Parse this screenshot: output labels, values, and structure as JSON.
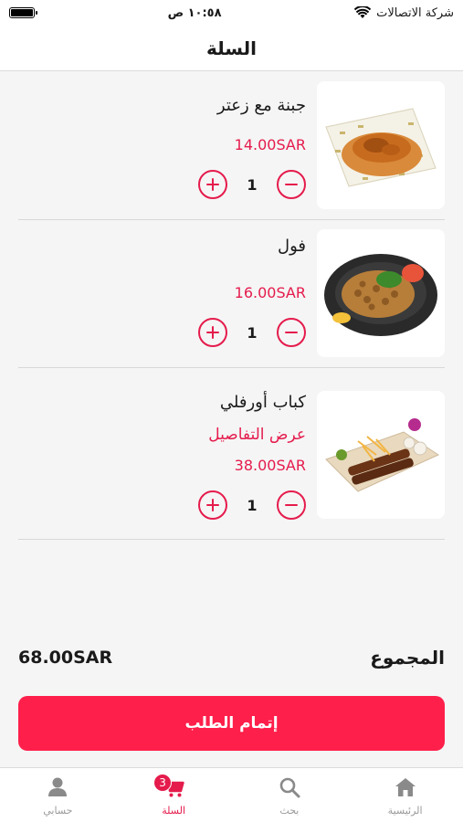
{
  "status_bar": {
    "carrier": "شركة الاتصالات",
    "time": "١٠:٥٨ ص"
  },
  "header": {
    "title": "السلة"
  },
  "cart": {
    "items": [
      {
        "name": "جبنة مع زعتر",
        "details": "",
        "price": "14.00SAR",
        "quantity": "1",
        "image_icon": "cheese-zaatar-dish"
      },
      {
        "name": "فول",
        "details": "",
        "price": "16.00SAR",
        "quantity": "1",
        "image_icon": "foul-dish"
      },
      {
        "name": "كباب أورفلي",
        "details": "عرض التفاصيل",
        "price": "38.00SAR",
        "quantity": "1",
        "image_icon": "kebab-dish"
      }
    ]
  },
  "total": {
    "label": "المجموع",
    "value": "68.00SAR"
  },
  "checkout": {
    "label": "إتمام الطلب"
  },
  "bottom_nav": {
    "items": [
      {
        "label": "حسابي",
        "icon": "person-icon"
      },
      {
        "label": "السلة",
        "icon": "cart-icon",
        "badge": "3",
        "active": true
      },
      {
        "label": "بحث",
        "icon": "search-icon"
      },
      {
        "label": "الرئيسية",
        "icon": "home-icon"
      }
    ]
  },
  "colors": {
    "accent": "#e51b4c",
    "button": "#ff1f4b",
    "background": "#f5f5f5"
  }
}
